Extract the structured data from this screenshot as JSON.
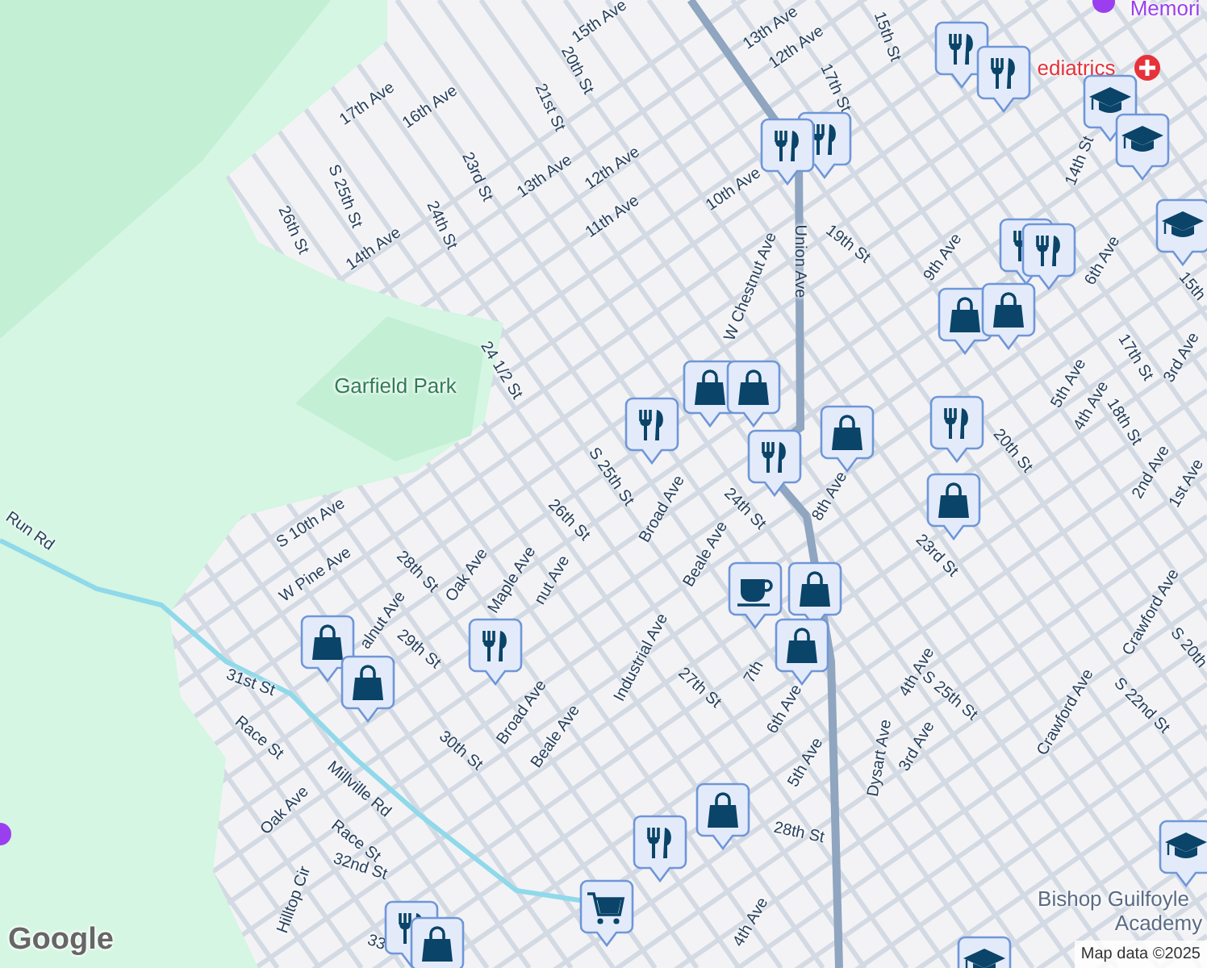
{
  "map": {
    "labels": [
      {
        "text": "15th Ave",
        "kind": "street"
      },
      {
        "text": "20th St",
        "kind": "street"
      },
      {
        "text": "13th Ave",
        "kind": "street"
      },
      {
        "text": "12th Ave",
        "kind": "street"
      },
      {
        "text": "15th St",
        "kind": "street"
      },
      {
        "text": "17th St",
        "kind": "street"
      },
      {
        "text": "Memori",
        "kind": "landmark"
      },
      {
        "text": "ediatrics",
        "kind": "hospital"
      },
      {
        "text": "17th Ave",
        "kind": "street"
      },
      {
        "text": "16th Ave",
        "kind": "street"
      },
      {
        "text": "21st St",
        "kind": "street"
      },
      {
        "text": "S 25th St",
        "kind": "street"
      },
      {
        "text": "13th Ave",
        "kind": "street"
      },
      {
        "text": "12th Ave",
        "kind": "street"
      },
      {
        "text": "23rd St",
        "kind": "street"
      },
      {
        "text": "26th St",
        "kind": "street"
      },
      {
        "text": "24th St",
        "kind": "street"
      },
      {
        "text": "14th Ave",
        "kind": "street"
      },
      {
        "text": "11th Ave",
        "kind": "street"
      },
      {
        "text": "10th Ave",
        "kind": "street"
      },
      {
        "text": "19th St",
        "kind": "street"
      },
      {
        "text": "Union Ave",
        "kind": "street"
      },
      {
        "text": "W Chestnut Ave",
        "kind": "street"
      },
      {
        "text": "9th Ave",
        "kind": "street"
      },
      {
        "text": "14th St",
        "kind": "street"
      },
      {
        "text": "6th Ave",
        "kind": "street"
      },
      {
        "text": "24 1/2 St",
        "kind": "street"
      },
      {
        "text": "Garfield Park",
        "kind": "park"
      },
      {
        "text": "5th Ave",
        "kind": "street"
      },
      {
        "text": "4th Ave",
        "kind": "street"
      },
      {
        "text": "17th St",
        "kind": "street"
      },
      {
        "text": "18th St",
        "kind": "street"
      },
      {
        "text": "20th St",
        "kind": "street"
      },
      {
        "text": "S 25th St",
        "kind": "street"
      },
      {
        "text": "Broad Ave",
        "kind": "street"
      },
      {
        "text": "24th St",
        "kind": "street"
      },
      {
        "text": "8th Ave",
        "kind": "street"
      },
      {
        "text": "Beale Ave",
        "kind": "street"
      },
      {
        "text": "23rd St",
        "kind": "street"
      },
      {
        "text": "S 10th Ave",
        "kind": "street"
      },
      {
        "text": "Run Rd",
        "kind": "street"
      },
      {
        "text": "W Pine Ave",
        "kind": "street"
      },
      {
        "text": "28th St",
        "kind": "street"
      },
      {
        "text": "Oak Ave",
        "kind": "street"
      },
      {
        "text": "Maple Ave",
        "kind": "street"
      },
      {
        "text": "26th St",
        "kind": "street"
      },
      {
        "text": "nut Ave",
        "kind": "street"
      },
      {
        "text": "alnut Ave",
        "kind": "street"
      },
      {
        "text": "29th St",
        "kind": "street"
      },
      {
        "text": "Broad Ave",
        "kind": "street"
      },
      {
        "text": "Beale Ave",
        "kind": "street"
      },
      {
        "text": "30th St",
        "kind": "street"
      },
      {
        "text": "31st St",
        "kind": "street"
      },
      {
        "text": "Race St",
        "kind": "street"
      },
      {
        "text": "Millville Rd",
        "kind": "street"
      },
      {
        "text": "Oak Ave",
        "kind": "street"
      },
      {
        "text": "Race St",
        "kind": "street"
      },
      {
        "text": "32nd St",
        "kind": "street"
      },
      {
        "text": "Hilltop Cir",
        "kind": "street"
      },
      {
        "text": "Industrial Ave",
        "kind": "street"
      },
      {
        "text": "27th St",
        "kind": "street"
      },
      {
        "text": "7th",
        "kind": "street"
      },
      {
        "text": "6th Ave",
        "kind": "street"
      },
      {
        "text": "5th Ave",
        "kind": "street"
      },
      {
        "text": "28th St",
        "kind": "street"
      },
      {
        "text": "4th Ave",
        "kind": "street"
      },
      {
        "text": "Dysart Ave",
        "kind": "street"
      },
      {
        "text": "4th Ave",
        "kind": "street"
      },
      {
        "text": "S 25th St",
        "kind": "street"
      },
      {
        "text": "3rd Ave",
        "kind": "street"
      },
      {
        "text": "Crawford Ave",
        "kind": "street"
      },
      {
        "text": "Crawford Ave",
        "kind": "street"
      },
      {
        "text": "S 22nd St",
        "kind": "street"
      },
      {
        "text": "S 20th",
        "kind": "street"
      },
      {
        "text": "2nd Ave",
        "kind": "street"
      },
      {
        "text": "1st Ave",
        "kind": "street"
      },
      {
        "text": "3rd Ave",
        "kind": "street"
      },
      {
        "text": "Bishop Guilfoyle",
        "kind": "school"
      },
      {
        "text": "Academy",
        "kind": "school"
      },
      {
        "text": "33",
        "kind": "street"
      },
      {
        "text": "15th",
        "kind": "street"
      }
    ],
    "markers": [
      {
        "kind": "restaurant"
      },
      {
        "kind": "restaurant"
      },
      {
        "kind": "restaurant"
      },
      {
        "kind": "restaurant"
      },
      {
        "kind": "restaurant"
      },
      {
        "kind": "restaurant"
      },
      {
        "kind": "restaurant"
      },
      {
        "kind": "restaurant"
      },
      {
        "kind": "restaurant"
      },
      {
        "kind": "restaurant"
      },
      {
        "kind": "restaurant"
      },
      {
        "kind": "restaurant"
      },
      {
        "kind": "shopping"
      },
      {
        "kind": "shopping"
      },
      {
        "kind": "shopping"
      },
      {
        "kind": "shopping"
      },
      {
        "kind": "shopping"
      },
      {
        "kind": "shopping"
      },
      {
        "kind": "shopping"
      },
      {
        "kind": "shopping"
      },
      {
        "kind": "shopping"
      },
      {
        "kind": "shopping"
      },
      {
        "kind": "shopping"
      },
      {
        "kind": "shopping"
      },
      {
        "kind": "school"
      },
      {
        "kind": "school"
      },
      {
        "kind": "school"
      },
      {
        "kind": "school"
      },
      {
        "kind": "school"
      },
      {
        "kind": "coffee"
      },
      {
        "kind": "grocery"
      }
    ],
    "logo": "Google",
    "attribution": "Map data ©2025"
  }
}
